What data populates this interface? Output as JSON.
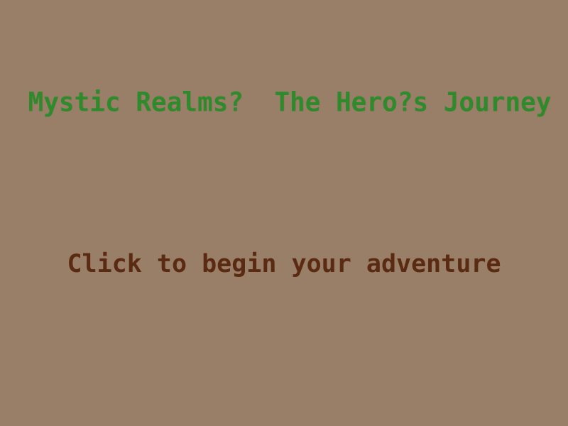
{
  "title_screen": {
    "title": "Mystic Realms?  The Hero?s Journey",
    "prompt": "Click to begin your adventure"
  },
  "colors": {
    "background": "#9a7f68",
    "title": "#2f8a2c",
    "prompt": "#5a2a12"
  }
}
